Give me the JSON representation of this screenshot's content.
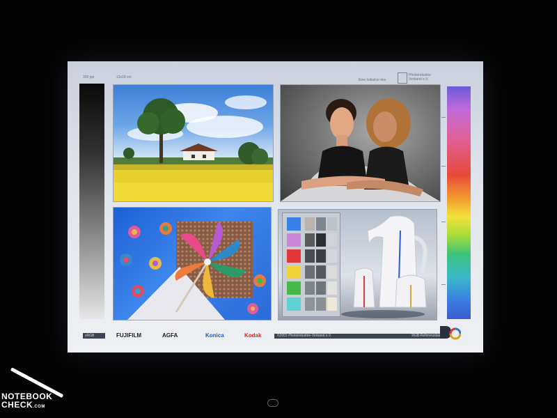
{
  "screen": {
    "resolution_note": "300 ppi",
    "size_note": "13x18 cm",
    "header_small": "Eine Initiative des",
    "header_org": "Photoindustrie Verband e.V."
  },
  "footer": {
    "srgb": "sRGB",
    "brands": [
      "FUJIFILM",
      "AGFA",
      "Konica",
      "Kodak"
    ],
    "copyright": "©2001 Photoindustrie-Verband e.V.",
    "reference": "RGB-Referenzdatei"
  },
  "color_chart": {
    "left_swatches": [
      "#3a7ee8",
      "#c985d8",
      "#e03838",
      "#f0d23a",
      "#46b84a",
      "#5fd0d8"
    ],
    "gray_columns": [
      [
        "#b9b2ad",
        "#7f858d",
        "#bcc2c8"
      ],
      [
        "#5a5a5a",
        "#2a2e33",
        "#cfd3d8"
      ],
      [
        "#484c52",
        "#3a3e45",
        "#d4d7db"
      ],
      [
        "#6c7076",
        "#555a60",
        "#dcdcdc"
      ],
      [
        "#7f8489",
        "#70757a",
        "#e2e2e2"
      ],
      [
        "#8e9398",
        "#8a8f94",
        "#efe7d8"
      ]
    ]
  },
  "watermark": {
    "line1": "NOTEBOOK",
    "line2": "CHECK",
    "suffix": ".COM"
  },
  "icons": [
    "dq-logo-icon",
    "power-button-icon",
    "notebookcheck-logo-icon"
  ]
}
